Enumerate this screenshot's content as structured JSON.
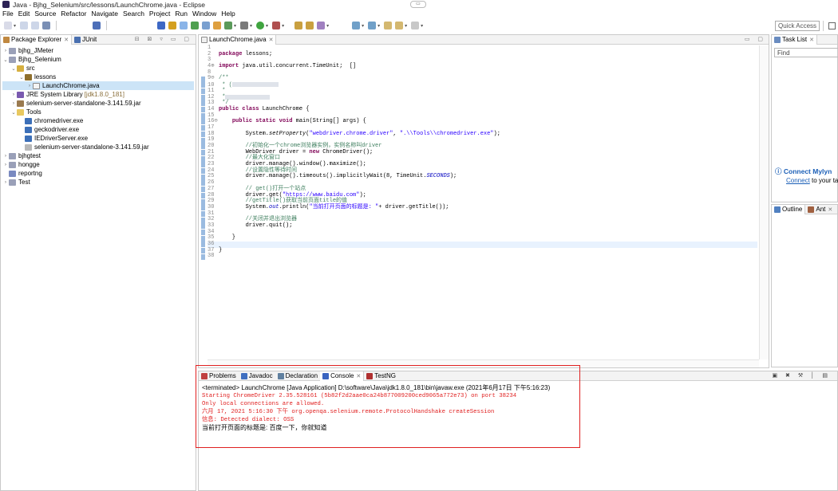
{
  "window": {
    "title": "Java - Bjhg_Selenium/src/lessons/LaunchChrome.java - Eclipse"
  },
  "menu": [
    "File",
    "Edit",
    "Source",
    "Refactor",
    "Navigate",
    "Search",
    "Project",
    "Run",
    "Window",
    "Help"
  ],
  "toolbar": {
    "quick_access": "Quick Access"
  },
  "package_explorer": {
    "tabs": [
      {
        "label": "Package Explorer",
        "active": true
      },
      {
        "label": "JUnit",
        "active": false
      }
    ],
    "tree": [
      {
        "indent": 0,
        "twisty": "›",
        "icon": "project",
        "label": "bjhg_JMeter",
        "suffix": ""
      },
      {
        "indent": 0,
        "twisty": "⌄",
        "icon": "project",
        "label": "Bjhg_Selenium",
        "suffix": ""
      },
      {
        "indent": 1,
        "twisty": "⌄",
        "icon": "src",
        "label": "src",
        "suffix": ""
      },
      {
        "indent": 2,
        "twisty": "⌄",
        "icon": "package",
        "label": "lessons",
        "suffix": ""
      },
      {
        "indent": 3,
        "twisty": "›",
        "icon": "java",
        "label": "LaunchChrome.java",
        "suffix": "",
        "selected": true
      },
      {
        "indent": 1,
        "twisty": "›",
        "icon": "library",
        "label": "JRE System Library",
        "suffix": "[jdk1.8.0_181]"
      },
      {
        "indent": 1,
        "twisty": "›",
        "icon": "jar",
        "label": "selenium-server-standalone-3.141.59.jar",
        "suffix": ""
      },
      {
        "indent": 1,
        "twisty": "⌄",
        "icon": "folder",
        "label": "Tools",
        "suffix": ""
      },
      {
        "indent": 2,
        "twisty": "",
        "icon": "exe",
        "label": "chromedriver.exe",
        "suffix": ""
      },
      {
        "indent": 2,
        "twisty": "",
        "icon": "exe",
        "label": "geckodriver.exe",
        "suffix": ""
      },
      {
        "indent": 2,
        "twisty": "",
        "icon": "exe",
        "label": "IEDriverServer.exe",
        "suffix": ""
      },
      {
        "indent": 2,
        "twisty": "",
        "icon": "jarfile",
        "label": "selenium-server-standalone-3.141.59.jar",
        "suffix": ""
      },
      {
        "indent": 0,
        "twisty": "›",
        "icon": "project",
        "label": "bjhgtest",
        "suffix": ""
      },
      {
        "indent": 0,
        "twisty": "›",
        "icon": "project",
        "label": "hongge",
        "suffix": ""
      },
      {
        "indent": 0,
        "twisty": "",
        "icon": "closedproject",
        "label": "reportng",
        "suffix": ""
      },
      {
        "indent": 0,
        "twisty": "›",
        "icon": "project",
        "label": "Test",
        "suffix": ""
      }
    ]
  },
  "editor": {
    "tab": "LaunchChrome.java",
    "lines": [
      {
        "n": "1",
        "html": ""
      },
      {
        "n": "2",
        "html": "<span class='kw'>package</span> lessons;"
      },
      {
        "n": "3",
        "html": ""
      },
      {
        "n": "4⊕",
        "html": "<span class='kw'>import</span> java.util.concurrent.TimeUnit;  []"
      },
      {
        "n": "8",
        "html": ""
      },
      {
        "n": "9⊖",
        "html": "<span class='cm'>/**</span>"
      },
      {
        "n": "10",
        "html": "<span class='cm'> * (</span><span class='blur' style='width:58px'></span>"
      },
      {
        "n": "11",
        "html": "<span class='cm'> *</span>"
      },
      {
        "n": "12",
        "html": "<span class='cm'> *</span><span class='blur' style='width:56px'></span>"
      },
      {
        "n": "13",
        "html": "<span class='cm'> */</span>"
      },
      {
        "n": "14",
        "html": "<span class='kw'>public class</span> LaunchChrome {"
      },
      {
        "n": "15",
        "html": ""
      },
      {
        "n": "16⊖",
        "html": "    <span class='kw'>public static void</span> main(String[] args) {"
      },
      {
        "n": "17",
        "html": ""
      },
      {
        "n": "18",
        "html": "        System.<i>setProperty</i>(<span class='str'>\"webdriver.chrome.driver\"</span>, <span class='str'>\".\\\\Tools\\\\chromedriver.exe\"</span>);"
      },
      {
        "n": "19",
        "html": ""
      },
      {
        "n": "20",
        "html": "        <span class='cm'>//初始化一个chrome浏览器实例，实例名称叫driver</span>"
      },
      {
        "n": "21",
        "html": "        WebDriver driver = <span class='kw'>new</span> ChromeDriver();"
      },
      {
        "n": "22",
        "html": "        <span class='cm'>//最大化窗口</span>"
      },
      {
        "n": "23",
        "html": "        driver.manage().window().maximize();"
      },
      {
        "n": "24",
        "html": "        <span class='cm'>//设置隐性等待时间</span>"
      },
      {
        "n": "25",
        "html": "        driver.manage().timeouts().implicitlyWait(8, TimeUnit.<span class='fld'>SECONDS</span>);"
      },
      {
        "n": "26",
        "html": ""
      },
      {
        "n": "27",
        "html": "        <span class='cm'>// get()打开一个站点</span>"
      },
      {
        "n": "28",
        "html": "        driver.get(<span class='str'>\"https://www.baidu.com\"</span>);"
      },
      {
        "n": "29",
        "html": "        <span class='cm'>//getTitle()获取当前页面title的值</span>"
      },
      {
        "n": "30",
        "html": "        System.<span class='fld'>out</span>.println(<span class='str'>\"当前打开页面的标题是: \"</span>+ driver.getTitle());"
      },
      {
        "n": "31",
        "html": ""
      },
      {
        "n": "32",
        "html": "        <span class='cm'>//关闭并退出浏览器</span>"
      },
      {
        "n": "33",
        "html": "        driver.quit();"
      },
      {
        "n": "34",
        "html": ""
      },
      {
        "n": "35",
        "html": "    }"
      },
      {
        "n": "36",
        "html": "",
        "current": true
      },
      {
        "n": "37",
        "html": "}"
      },
      {
        "n": "38",
        "html": ""
      }
    ]
  },
  "console": {
    "tabs": [
      {
        "label": "Problems",
        "active": false
      },
      {
        "label": "Javadoc",
        "active": false
      },
      {
        "label": "Declaration",
        "active": false
      },
      {
        "label": "Console",
        "active": true
      },
      {
        "label": "TestNG",
        "active": false
      }
    ],
    "terminated": "<terminated> LaunchChrome [Java Application] D:\\software\\Java\\jdk1.8.0_181\\bin\\javaw.exe (2021年6月17日 下午5:16:23)",
    "output": [
      {
        "text": "Starting ChromeDriver 2.35.528161 (5b82f2d2aae0ca24b877009200ced9065a772e73) on port 38234",
        "color": "red"
      },
      {
        "text": "Only local connections are allowed.",
        "color": "red"
      },
      {
        "text": "六月 17, 2021 5:16:30 下午 org.openqa.selenium.remote.ProtocolHandshake createSession",
        "color": "red"
      },
      {
        "text": "信息: Detected dialect: OSS",
        "color": "red"
      },
      {
        "text": "当前打开页面的标题是: 百度一下，你就知道",
        "color": "black"
      }
    ]
  },
  "task_list": {
    "tab": "Task List",
    "find_placeholder": "Find"
  },
  "mylyn": {
    "title": "Connect Mylyn",
    "link": "Connect",
    "rest": " to your ta"
  },
  "outline": {
    "tabs": [
      "Outline",
      "Ant"
    ]
  }
}
